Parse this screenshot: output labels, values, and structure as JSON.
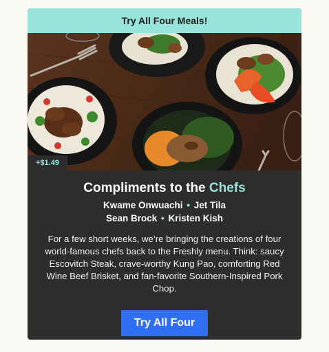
{
  "banner": {
    "label": "Try All Four Meals!"
  },
  "hero": {
    "price_tag": "+$1.49"
  },
  "headline": {
    "main": "Compliments to the ",
    "accent": "Chefs"
  },
  "chefs": {
    "line1": [
      "Kwame Onwuachi",
      "Jet Tila"
    ],
    "line2": [
      "Sean Brock",
      "Kristen Kish"
    ],
    "separator": "•"
  },
  "description": "For a few short weeks, we’re bringing the creations of four world-famous chefs back to the Freshly menu. Think: saucy Escovitch Steak, crave-worthy Kung Pao, comforting Red Wine Beef Brisket, and fan-favorite Southern-Inspired Pork Chop.",
  "cta": {
    "label": "Try All Four"
  },
  "colors": {
    "accent": "#97e5da",
    "card_bg": "#2d2d2d",
    "button": "#2f6ef2",
    "page_bg": "#fbfaf5"
  }
}
